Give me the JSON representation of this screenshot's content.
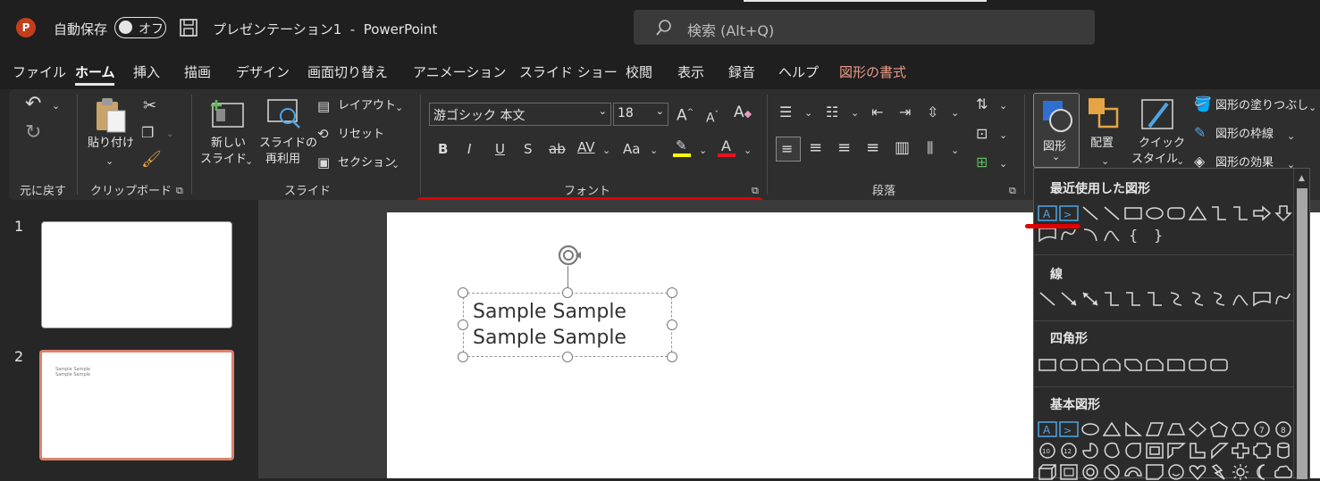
{
  "titlebar": {
    "autosave_label": "自動保存",
    "autosave_state": "オフ",
    "document_title": "プレゼンテーション1  -  PowerPoint",
    "search_placeholder": "検索 (Alt+Q)"
  },
  "tabs": [
    "ファイル",
    "ホーム",
    "挿入",
    "描画",
    "デザイン",
    "画面切り替え",
    "アニメーション",
    "スライド ショー",
    "校閲",
    "表示",
    "録音",
    "ヘルプ",
    "図形の書式"
  ],
  "active_tab": "ホーム",
  "ribbon": {
    "undo": {
      "group": "元に戻す"
    },
    "clipboard": {
      "paste": "貼り付け",
      "group": "クリップボード"
    },
    "slides": {
      "new_slide_line1": "新しい",
      "new_slide_line2": "スライド",
      "reuse_line1": "スライドの",
      "reuse_line2": "再利用",
      "layout": "レイアウト",
      "reset": "リセット",
      "section": "セクション",
      "group": "スライド"
    },
    "font": {
      "font_name": "游ゴシック 本文",
      "font_size": "18",
      "bold": "B",
      "italic": "I",
      "underline": "U",
      "strike": "S",
      "strike2": "ab",
      "spacing": "AV",
      "case": "Aa",
      "highlight_color": "#ffff00",
      "font_color": "#e81123",
      "group": "フォント"
    },
    "paragraph": {
      "group": "段落"
    },
    "drawing": {
      "shapes": "図形",
      "arrange": "配置",
      "quick_style_line1": "クイック",
      "quick_style_line2": "スタイル",
      "fill": "図形の塗りつぶし",
      "outline": "図形の枠線",
      "effect": "図形の効果"
    }
  },
  "slide_pane": {
    "slides": [
      {
        "number": "1"
      },
      {
        "number": "2",
        "text_line1": "Sample Sample",
        "text_line2": "Sample Sample"
      }
    ]
  },
  "textbox": {
    "line1": "Sample Sample",
    "line2": "Sample Sample"
  },
  "shapes_panel": {
    "sections": [
      "最近使用した図形",
      "線",
      "四角形",
      "基本図形"
    ]
  },
  "colors": {
    "accent": "#c43e1c",
    "annotation_red": "#e00000",
    "selection_blue": "#2f6fd1"
  }
}
